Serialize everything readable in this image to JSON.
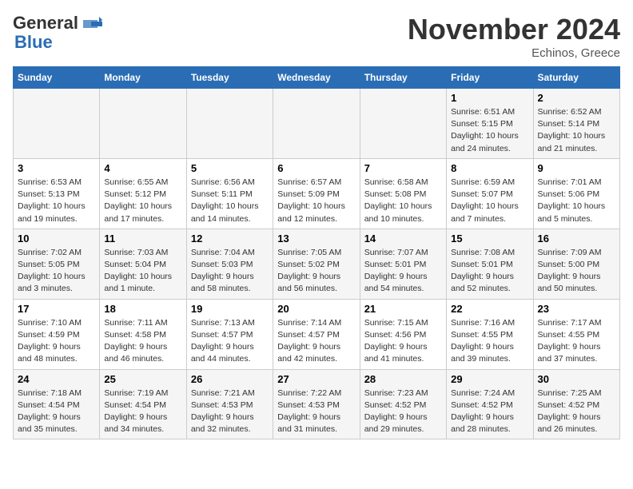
{
  "header": {
    "logo_general": "General",
    "logo_blue": "Blue",
    "month_title": "November 2024",
    "location": "Echinos, Greece"
  },
  "columns": [
    "Sunday",
    "Monday",
    "Tuesday",
    "Wednesday",
    "Thursday",
    "Friday",
    "Saturday"
  ],
  "weeks": [
    {
      "days": [
        {
          "num": "",
          "info": ""
        },
        {
          "num": "",
          "info": ""
        },
        {
          "num": "",
          "info": ""
        },
        {
          "num": "",
          "info": ""
        },
        {
          "num": "",
          "info": ""
        },
        {
          "num": "1",
          "info": "Sunrise: 6:51 AM\nSunset: 5:15 PM\nDaylight: 10 hours\nand 24 minutes."
        },
        {
          "num": "2",
          "info": "Sunrise: 6:52 AM\nSunset: 5:14 PM\nDaylight: 10 hours\nand 21 minutes."
        }
      ]
    },
    {
      "days": [
        {
          "num": "3",
          "info": "Sunrise: 6:53 AM\nSunset: 5:13 PM\nDaylight: 10 hours\nand 19 minutes."
        },
        {
          "num": "4",
          "info": "Sunrise: 6:55 AM\nSunset: 5:12 PM\nDaylight: 10 hours\nand 17 minutes."
        },
        {
          "num": "5",
          "info": "Sunrise: 6:56 AM\nSunset: 5:11 PM\nDaylight: 10 hours\nand 14 minutes."
        },
        {
          "num": "6",
          "info": "Sunrise: 6:57 AM\nSunset: 5:09 PM\nDaylight: 10 hours\nand 12 minutes."
        },
        {
          "num": "7",
          "info": "Sunrise: 6:58 AM\nSunset: 5:08 PM\nDaylight: 10 hours\nand 10 minutes."
        },
        {
          "num": "8",
          "info": "Sunrise: 6:59 AM\nSunset: 5:07 PM\nDaylight: 10 hours\nand 7 minutes."
        },
        {
          "num": "9",
          "info": "Sunrise: 7:01 AM\nSunset: 5:06 PM\nDaylight: 10 hours\nand 5 minutes."
        }
      ]
    },
    {
      "days": [
        {
          "num": "10",
          "info": "Sunrise: 7:02 AM\nSunset: 5:05 PM\nDaylight: 10 hours\nand 3 minutes."
        },
        {
          "num": "11",
          "info": "Sunrise: 7:03 AM\nSunset: 5:04 PM\nDaylight: 10 hours\nand 1 minute."
        },
        {
          "num": "12",
          "info": "Sunrise: 7:04 AM\nSunset: 5:03 PM\nDaylight: 9 hours\nand 58 minutes."
        },
        {
          "num": "13",
          "info": "Sunrise: 7:05 AM\nSunset: 5:02 PM\nDaylight: 9 hours\nand 56 minutes."
        },
        {
          "num": "14",
          "info": "Sunrise: 7:07 AM\nSunset: 5:01 PM\nDaylight: 9 hours\nand 54 minutes."
        },
        {
          "num": "15",
          "info": "Sunrise: 7:08 AM\nSunset: 5:01 PM\nDaylight: 9 hours\nand 52 minutes."
        },
        {
          "num": "16",
          "info": "Sunrise: 7:09 AM\nSunset: 5:00 PM\nDaylight: 9 hours\nand 50 minutes."
        }
      ]
    },
    {
      "days": [
        {
          "num": "17",
          "info": "Sunrise: 7:10 AM\nSunset: 4:59 PM\nDaylight: 9 hours\nand 48 minutes."
        },
        {
          "num": "18",
          "info": "Sunrise: 7:11 AM\nSunset: 4:58 PM\nDaylight: 9 hours\nand 46 minutes."
        },
        {
          "num": "19",
          "info": "Sunrise: 7:13 AM\nSunset: 4:57 PM\nDaylight: 9 hours\nand 44 minutes."
        },
        {
          "num": "20",
          "info": "Sunrise: 7:14 AM\nSunset: 4:57 PM\nDaylight: 9 hours\nand 42 minutes."
        },
        {
          "num": "21",
          "info": "Sunrise: 7:15 AM\nSunset: 4:56 PM\nDaylight: 9 hours\nand 41 minutes."
        },
        {
          "num": "22",
          "info": "Sunrise: 7:16 AM\nSunset: 4:55 PM\nDaylight: 9 hours\nand 39 minutes."
        },
        {
          "num": "23",
          "info": "Sunrise: 7:17 AM\nSunset: 4:55 PM\nDaylight: 9 hours\nand 37 minutes."
        }
      ]
    },
    {
      "days": [
        {
          "num": "24",
          "info": "Sunrise: 7:18 AM\nSunset: 4:54 PM\nDaylight: 9 hours\nand 35 minutes."
        },
        {
          "num": "25",
          "info": "Sunrise: 7:19 AM\nSunset: 4:54 PM\nDaylight: 9 hours\nand 34 minutes."
        },
        {
          "num": "26",
          "info": "Sunrise: 7:21 AM\nSunset: 4:53 PM\nDaylight: 9 hours\nand 32 minutes."
        },
        {
          "num": "27",
          "info": "Sunrise: 7:22 AM\nSunset: 4:53 PM\nDaylight: 9 hours\nand 31 minutes."
        },
        {
          "num": "28",
          "info": "Sunrise: 7:23 AM\nSunset: 4:52 PM\nDaylight: 9 hours\nand 29 minutes."
        },
        {
          "num": "29",
          "info": "Sunrise: 7:24 AM\nSunset: 4:52 PM\nDaylight: 9 hours\nand 28 minutes."
        },
        {
          "num": "30",
          "info": "Sunrise: 7:25 AM\nSunset: 4:52 PM\nDaylight: 9 hours\nand 26 minutes."
        }
      ]
    }
  ]
}
